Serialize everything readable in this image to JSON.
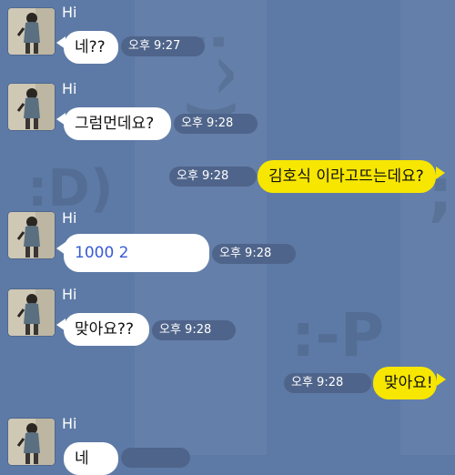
{
  "background": {
    "color": "#5d7aa6",
    "emoticons": [
      ":^)",
      ":D)",
      ";",
      ":-P"
    ]
  },
  "colors": {
    "bubble_received": "#ffffff",
    "bubble_sent": "#f7e600",
    "time_pill": "#4f648a",
    "link": "#3a59d6"
  },
  "messages": [
    {
      "sender": "Hi",
      "text": "네??",
      "time": "오후 9:27",
      "direction": "received"
    },
    {
      "sender": "Hi",
      "text": "그럼먼데요?",
      "time": "오후 9:28",
      "direction": "received"
    },
    {
      "text": "김호식 이라고뜨는데요?",
      "time": "오후 9:28",
      "direction": "sent"
    },
    {
      "sender": "Hi",
      "text": "1000 2",
      "time": "오후 9:28",
      "direction": "received",
      "is_link": true
    },
    {
      "sender": "Hi",
      "text": "맞아요??",
      "time": "오후 9:28",
      "direction": "received"
    },
    {
      "text": "맞아요!",
      "time": "오후 9:28",
      "direction": "sent"
    },
    {
      "sender": "Hi",
      "text": "네",
      "time": "",
      "direction": "received"
    }
  ]
}
